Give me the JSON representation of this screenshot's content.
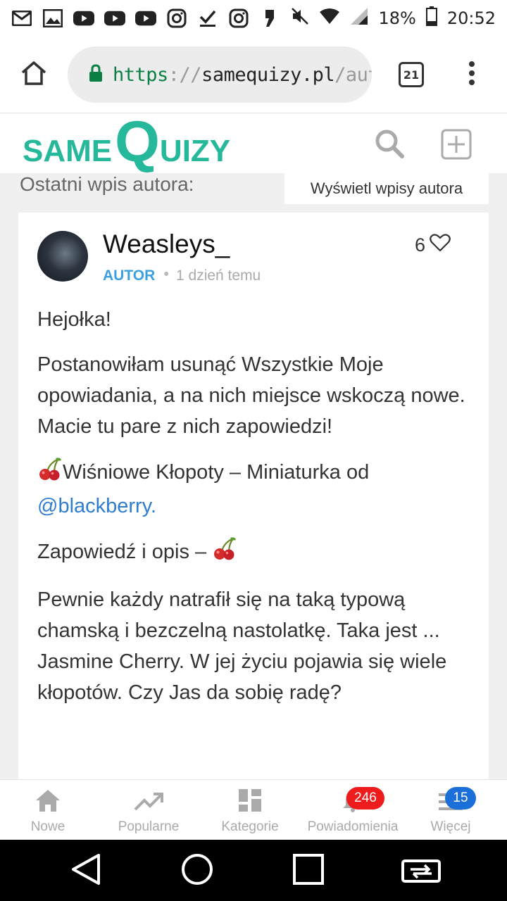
{
  "status_bar": {
    "icons": [
      "gmail-icon",
      "gallery-icon",
      "youtube-icon",
      "youtube-icon",
      "youtube-icon",
      "instagram-icon",
      "task-icon",
      "instagram-icon",
      "quote-icon"
    ],
    "battery": "18%",
    "time": "20:52"
  },
  "browser": {
    "url_scheme": "https",
    "url_sep": "://",
    "url_host": "samequizy.pl",
    "url_tail": "/aut",
    "tab_count": "21"
  },
  "site": {
    "logo_left": "SAME",
    "logo_q": "Q",
    "logo_right": "UIZY",
    "accent": "#25b89a"
  },
  "author_bar": {
    "label": "Ostatni wpis autora:",
    "button": "Wyświetl wpisy autora"
  },
  "post": {
    "author": "Weasleys_",
    "role": "AUTOR",
    "separator": "•",
    "time": "1 dzień temu",
    "likes": "6",
    "p1": "Hejołka!",
    "p2a": "Postanowiłam usunąć Wszystkie Moje opowiadania, a na nich miejsce wskoczą nowe.",
    "p2b": "Macie tu pare z nich zapowiedzi!",
    "p3": "Wiśniowe Kłopoty – Miniaturka od",
    "p3_mention": "@blackberry.",
    "p4": "Zapowiedź i opis –",
    "p5": "Pewnie każdy natrafił się na taką typową chamską i bezczelną nastolatkę. Taka jest ... Jasmine Cherry. W jej życiu pojawia się wiele kłopotów. Czy Jas da sobię radę?"
  },
  "nav": {
    "items": [
      {
        "label": "Nowe",
        "icon": "home-icon"
      },
      {
        "label": "Popularne",
        "icon": "trending-icon"
      },
      {
        "label": "Kategorie",
        "icon": "grid-icon"
      },
      {
        "label": "Powiadomienia",
        "icon": "bell-icon"
      },
      {
        "label": "Więcej",
        "icon": "menu-icon"
      }
    ],
    "notif_badge": "246",
    "more_badge": "15"
  }
}
